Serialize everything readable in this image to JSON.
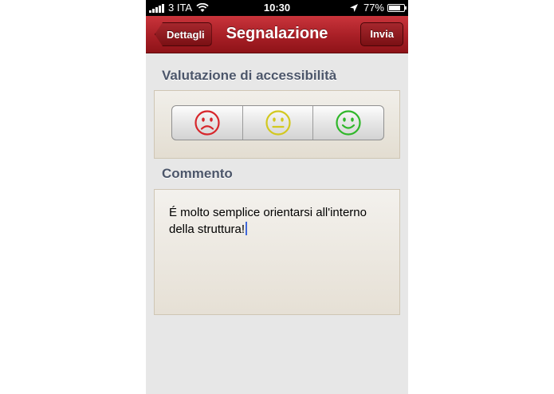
{
  "status_bar": {
    "carrier": "3 ITA",
    "time": "10:30",
    "battery": "77%",
    "battery_level": 0.77
  },
  "nav_bar": {
    "back_label": "Dettagli",
    "title": "Segnalazione",
    "send_label": "Invia"
  },
  "rating": {
    "header": "Valutazione di accessibilità",
    "options": [
      {
        "icon": "sad-face-icon",
        "color": "#d7262b"
      },
      {
        "icon": "neutral-face-icon",
        "color": "#d2c81f"
      },
      {
        "icon": "happy-face-icon",
        "color": "#30b72a"
      }
    ]
  },
  "comment": {
    "header": "Commento",
    "text": "É molto semplice orientarsi all'interno della struttura!"
  }
}
